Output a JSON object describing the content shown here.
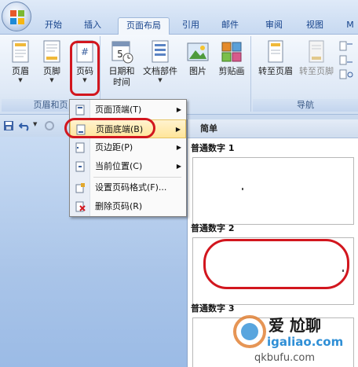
{
  "tabs": [
    "开始",
    "插入",
    "页面布局",
    "引用",
    "邮件",
    "审阅",
    "视图",
    "M"
  ],
  "ribbon": {
    "group_header_footer": {
      "label": "页眉和页",
      "buttons": [
        "页眉",
        "页脚",
        "页码"
      ]
    },
    "group_insert": {
      "buttons": [
        "日期和\n时间",
        "文档部件",
        "图片",
        "剪贴画"
      ]
    },
    "group_nav": {
      "label": "导航",
      "buttons": [
        "转至页眉",
        "转至页脚"
      ]
    }
  },
  "menu": {
    "items": [
      {
        "label": "页面顶端(T)",
        "has_submenu": true,
        "icon": "page-top-icon"
      },
      {
        "label": "页面底端(B)",
        "has_submenu": true,
        "icon": "page-bottom-icon"
      },
      {
        "label": "页边距(P)",
        "has_submenu": true,
        "icon": "page-margin-icon"
      },
      {
        "label": "当前位置(C)",
        "has_submenu": true,
        "icon": "current-position-icon"
      },
      {
        "label": "设置页码格式(F)...",
        "has_submenu": false,
        "icon": "format-page-number-icon"
      },
      {
        "label": "删除页码(R)",
        "has_submenu": false,
        "icon": "delete-page-number-icon"
      }
    ]
  },
  "gallery": {
    "header": "简单",
    "sections": [
      "普通数字 1",
      "普通数字 2",
      "普通数字 3"
    ]
  },
  "watermark": {
    "text1": "爱 尬聊",
    "text2": "igaliao.com",
    "text3": "qkbufu.com"
  },
  "colors": {
    "highlight": "#d2161e",
    "tab_text": "#15428b",
    "menu_hover": "#ffe59a"
  }
}
